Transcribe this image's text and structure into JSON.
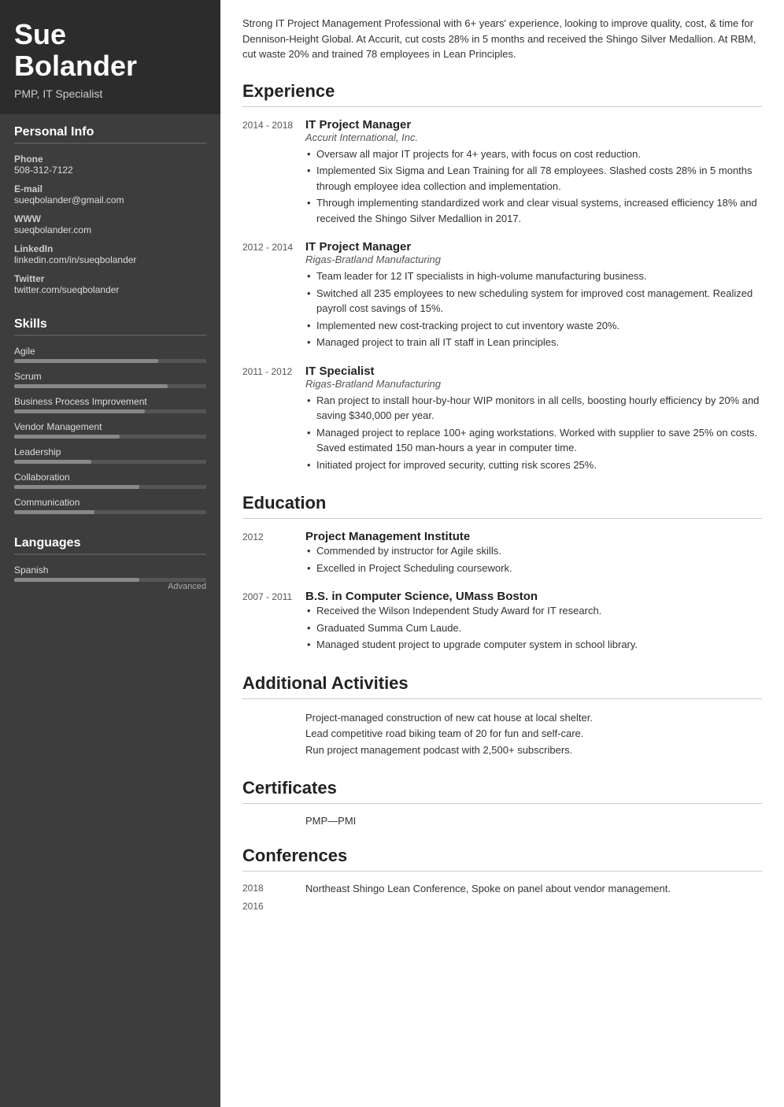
{
  "sidebar": {
    "name": "Sue\nBolander",
    "name_first": "Sue",
    "name_last": "Bolander",
    "subtitle": "PMP, IT Specialist",
    "sections": {
      "personal_info": {
        "title": "Personal Info",
        "items": [
          {
            "label": "Phone",
            "value": "508-312-7122"
          },
          {
            "label": "E-mail",
            "value": "sueqbolander@gmail.com"
          },
          {
            "label": "WWW",
            "value": "sueqbolander.com"
          },
          {
            "label": "LinkedIn",
            "value": "linkedin.com/in/sueqbolander"
          },
          {
            "label": "Twitter",
            "value": "twitter.com/sueqbolander"
          }
        ]
      },
      "skills": {
        "title": "Skills",
        "items": [
          {
            "name": "Agile",
            "percent": 75
          },
          {
            "name": "Scrum",
            "percent": 80
          },
          {
            "name": "Business Process Improvement",
            "percent": 68
          },
          {
            "name": "Vendor Management",
            "percent": 55
          },
          {
            "name": "Leadership",
            "percent": 40
          },
          {
            "name": "Collaboration",
            "percent": 65
          },
          {
            "name": "Communication",
            "percent": 42
          }
        ]
      },
      "languages": {
        "title": "Languages",
        "items": [
          {
            "name": "Spanish",
            "percent": 65,
            "level": "Advanced"
          }
        ]
      }
    }
  },
  "main": {
    "summary": "Strong IT Project Management Professional with 6+ years' experience, looking to improve quality, cost, & time for Dennison-Height Global. At Accurit, cut costs 28% in 5 months and received the Shingo Silver Medallion. At RBM, cut waste 20% and trained 78 employees in Lean Principles.",
    "sections": {
      "experience": {
        "title": "Experience",
        "entries": [
          {
            "date": "2014 - 2018",
            "title": "IT Project Manager",
            "company": "Accurit International, Inc.",
            "bullets": [
              "Oversaw all major IT projects for 4+ years, with focus on cost reduction.",
              "Implemented Six Sigma and Lean Training for all 78 employees. Slashed costs 28% in 5 months through employee idea collection and implementation.",
              "Through implementing standardized work and clear visual systems, increased efficiency 18% and received the Shingo Silver Medallion in 2017."
            ]
          },
          {
            "date": "2012 - 2014",
            "title": "IT Project Manager",
            "company": "Rigas-Bratland Manufacturing",
            "bullets": [
              "Team leader for 12 IT specialists in high-volume manufacturing business.",
              "Switched all 235 employees to new scheduling system for improved cost management. Realized payroll cost savings of 15%.",
              "Implemented new cost-tracking project to cut inventory waste 20%.",
              "Managed project to train all IT staff in Lean principles."
            ]
          },
          {
            "date": "2011 - 2012",
            "title": "IT Specialist",
            "company": "Rigas-Bratland Manufacturing",
            "bullets": [
              "Ran project to install hour-by-hour WIP monitors in all cells, boosting hourly efficiency by 20% and saving $340,000 per year.",
              "Managed project to replace 100+ aging workstations. Worked with supplier to save 25% on costs. Saved estimated 150 man-hours a year in computer time.",
              "Initiated project for improved security, cutting risk scores 25%."
            ]
          }
        ]
      },
      "education": {
        "title": "Education",
        "entries": [
          {
            "date": "2012",
            "title": "Project Management Institute",
            "company": "",
            "bullets": [
              "Commended by instructor for Agile skills.",
              "Excelled in Project Scheduling coursework."
            ]
          },
          {
            "date": "2007 - 2011",
            "title": "B.S. in Computer Science, UMass Boston",
            "company": "",
            "bullets": [
              "Received the Wilson Independent Study Award for IT research.",
              "Graduated Summa Cum Laude.",
              "Managed student project to upgrade computer system in school library."
            ]
          }
        ]
      },
      "additional_activities": {
        "title": "Additional Activities",
        "items": [
          "Project-managed construction of new cat house at local shelter.",
          "Lead competitive road biking team of 20 for fun and self-care.",
          "Run project management podcast with 2,500+ subscribers."
        ]
      },
      "certificates": {
        "title": "Certificates",
        "items": [
          "PMP—PMI"
        ]
      },
      "conferences": {
        "title": "Conferences",
        "entries": [
          {
            "date": "2018",
            "text": "Northeast Shingo Lean Conference, Spoke on panel about vendor management."
          },
          {
            "date": "2016",
            "text": ""
          }
        ]
      }
    }
  }
}
